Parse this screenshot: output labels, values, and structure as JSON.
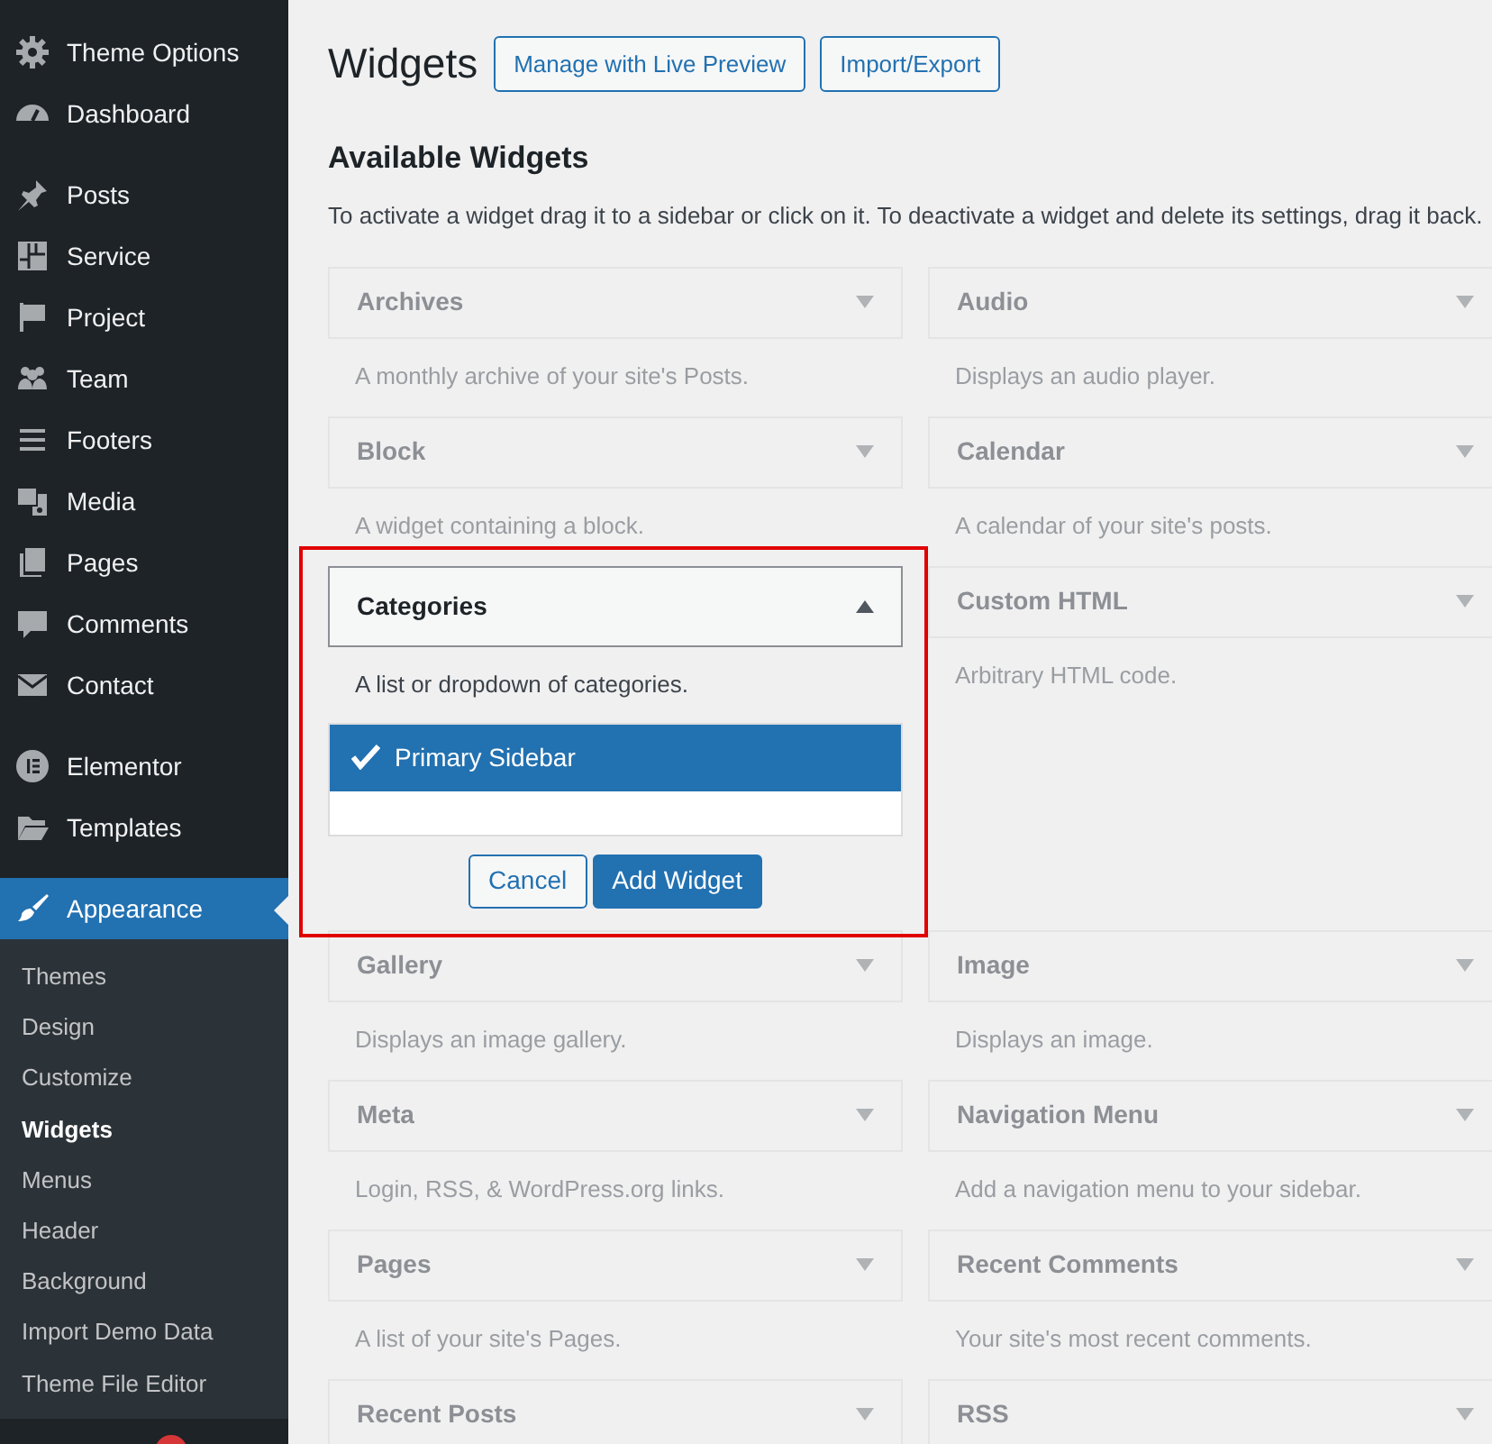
{
  "sidebar": {
    "groups": [
      {
        "items": [
          {
            "label": "Theme Options",
            "selected": false
          },
          {
            "label": "Dashboard",
            "selected": false
          }
        ]
      },
      {
        "items": [
          {
            "label": "Posts",
            "selected": false
          },
          {
            "label": "Service",
            "selected": false
          },
          {
            "label": "Project",
            "selected": false
          },
          {
            "label": "Team",
            "selected": false
          },
          {
            "label": "Footers",
            "selected": false
          },
          {
            "label": "Media",
            "selected": false
          },
          {
            "label": "Pages",
            "selected": false
          },
          {
            "label": "Comments",
            "selected": false
          },
          {
            "label": "Contact",
            "selected": false
          }
        ]
      },
      {
        "items": [
          {
            "label": "Elementor",
            "selected": false
          },
          {
            "label": "Templates",
            "selected": false
          }
        ]
      },
      {
        "items": [
          {
            "label": "Appearance",
            "selected": true,
            "submenu": [
              {
                "label": "Themes",
                "selected": false
              },
              {
                "label": "Design",
                "selected": false
              },
              {
                "label": "Customize",
                "selected": false
              },
              {
                "label": "Widgets",
                "selected": true
              },
              {
                "label": "Menus",
                "selected": false
              },
              {
                "label": "Header",
                "selected": false
              },
              {
                "label": "Background",
                "selected": false
              },
              {
                "label": "Import Demo Data",
                "selected": false
              },
              {
                "label": "Theme File Editor",
                "selected": false
              }
            ]
          }
        ]
      }
    ]
  },
  "page": {
    "title": "Widgets",
    "buttons": [
      "Manage with Live Preview",
      "Import/Export"
    ]
  },
  "available": {
    "heading": "Available Widgets",
    "instructions": "To activate a widget drag it to a sidebar or click on it. To deactivate a widget and delete its settings, drag it back.",
    "widgets": [
      {
        "title": "Archives",
        "description": "A monthly archive of your site's Posts.",
        "expanded": false
      },
      {
        "title": "Audio",
        "description": "Displays an audio player.",
        "expanded": false
      },
      {
        "title": "Block",
        "description": "A widget containing a block.",
        "expanded": false
      },
      {
        "title": "Calendar",
        "description": "A calendar of your site's posts.",
        "expanded": false
      },
      {
        "title": "Categories",
        "description": "A list or dropdown of categories.",
        "expanded": true,
        "highlighted": true,
        "chooser": {
          "sidebars": [
            {
              "label": "Primary Sidebar",
              "selected": true
            }
          ],
          "buttons": [
            "Cancel",
            "Add Widget"
          ]
        }
      },
      {
        "title": "Custom HTML",
        "description": "Arbitrary HTML code.",
        "expanded": false
      },
      {
        "title": "Gallery",
        "description": "Displays an image gallery.",
        "expanded": false
      },
      {
        "title": "Image",
        "description": "Displays an image.",
        "expanded": false
      },
      {
        "title": "Meta",
        "description": "Login, RSS, & WordPress.org links.",
        "expanded": false
      },
      {
        "title": "Navigation Menu",
        "description": "Add a navigation menu to your sidebar.",
        "expanded": false
      },
      {
        "title": "Pages",
        "description": "A list of your site's Pages.",
        "expanded": false
      },
      {
        "title": "Recent Comments",
        "description": "Your site's most recent comments.",
        "expanded": false
      },
      {
        "title": "Recent Posts",
        "expanded": false
      },
      {
        "title": "RSS",
        "expanded": false
      }
    ]
  }
}
